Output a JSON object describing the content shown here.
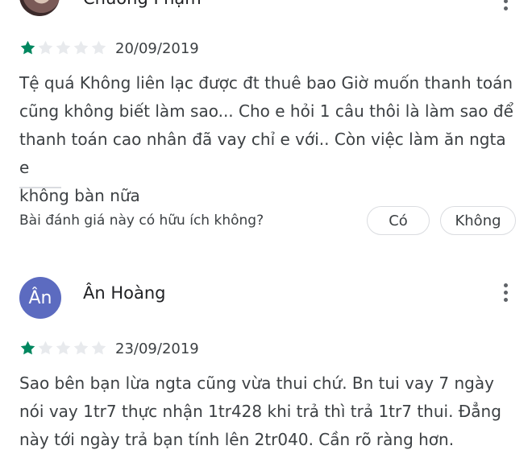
{
  "colors": {
    "star_filled": "#01875f",
    "star_empty": "#e8eaed",
    "avatar_bg": "#5c6bc0"
  },
  "reviews": [
    {
      "name": "Chương Phạm",
      "rating": 1,
      "max_rating": 5,
      "date": "20/09/2019",
      "text_lines": [
        "Tệ quá Không liên lạc được đt thuê bao Giờ muốn thanh toán",
        "cũng không biết làm sao... Cho e hỏi 1 câu thôi là làm sao để",
        "thanh toán cao nhân đã vay chỉ e với.. Còn việc làm ăn ngta e",
        "không bàn nữa"
      ],
      "helpful_question": "Bài đánh giá này có hữu ích không?",
      "yes_label": "Có",
      "no_label": "Không"
    },
    {
      "name": "Ân Hoàng",
      "avatar_initial": "Ân",
      "rating": 1,
      "max_rating": 5,
      "date": "23/09/2019",
      "text_lines": [
        "Sao bên bạn lừa ngta cũng vừa thui chứ. Bn tui vay 7 ngày",
        "nói vay 1tr7 thực nhận 1tr428 khi trả thì trả 1tr7 thui. Đẳng",
        "này tới ngày trả bạn tính lên 2tr040. Cần rõ ràng hơn."
      ]
    }
  ]
}
